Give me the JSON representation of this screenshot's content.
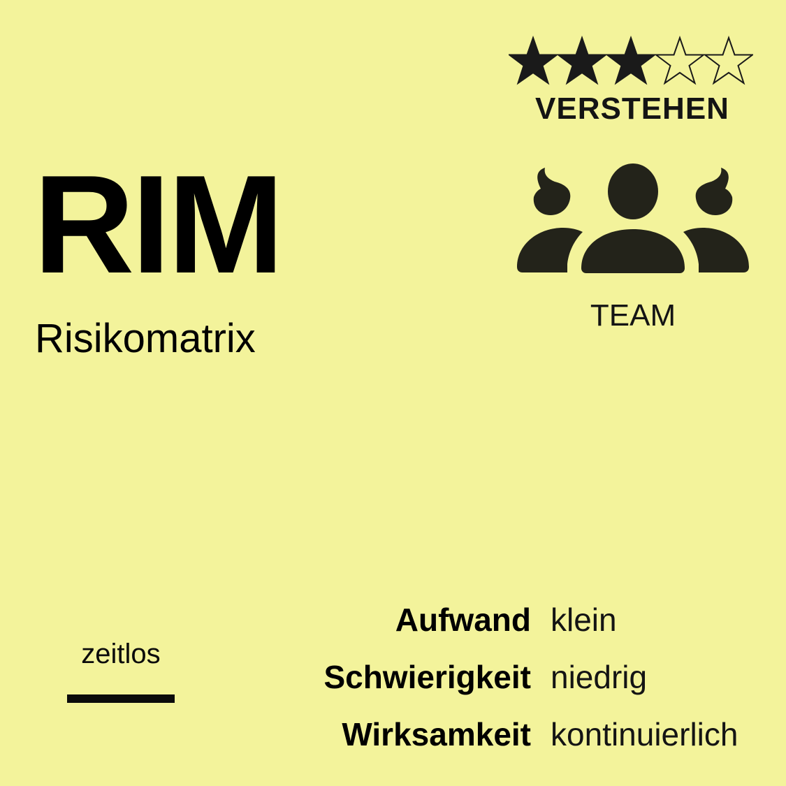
{
  "card": {
    "abbreviation": "RIM",
    "full_name": "Risikomatrix",
    "rating": {
      "value": 3,
      "max": 5,
      "icon": "star-icon"
    },
    "category": "VERSTEHEN",
    "audience": {
      "icon": "team-icon",
      "label": "TEAM"
    },
    "time_tag": "zeitlos",
    "properties": [
      {
        "label": "Aufwand",
        "value": "klein"
      },
      {
        "label": "Schwierigkeit",
        "value": "niedrig"
      },
      {
        "label": "Wirksamkeit",
        "value": "kontinuierlich"
      }
    ]
  },
  "colors": {
    "background": "#f3f39b",
    "text": "#000000",
    "icon": "#23231a"
  }
}
